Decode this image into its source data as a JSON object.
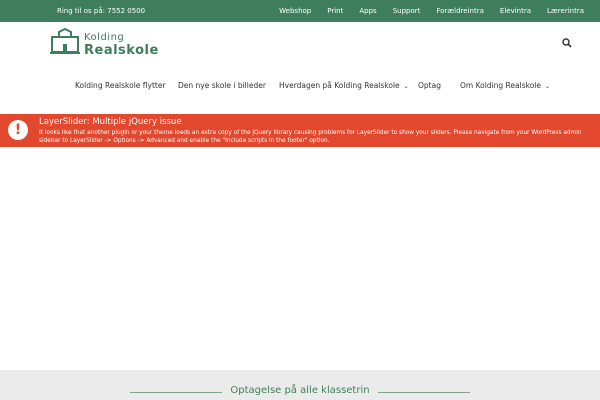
{
  "topbar": {
    "phone": "Ring til os på: 7552 0500",
    "links": [
      "Webshop",
      "Print",
      "Apps",
      "Support",
      "Forældreintra",
      "Elevintra",
      "Lærerintra"
    ]
  },
  "logo": {
    "line1": "Kolding",
    "line2": "Realskole"
  },
  "nav": {
    "items": [
      {
        "label": "Kolding Realskole flytter"
      },
      {
        "label": "Den nye skole i billeder"
      },
      {
        "label": "Hverdagen på Kolding Realskole",
        "dropdown": true
      },
      {
        "label": "Optag"
      },
      {
        "label": "Om Kolding Realskole",
        "dropdown": true
      }
    ],
    "chevron": "⌄"
  },
  "notice": {
    "badge": "!",
    "title": "LayerSlider: Multiple jQuery issue",
    "message": "It looks like that another plugin or your theme loads an extra copy of the jQuery library causing problems for LayerSlider to show your sliders. Please navigate from your WordPress admin sidebar to LayerSlider -> Options -> Advanced and enable the \"Include scripts in the footer\" option."
  },
  "section": {
    "heading": "Optagelse på alle klassetrin"
  },
  "colors": {
    "brand_green": "#3f7e5d",
    "notice_red": "#e1482e",
    "footer_gray": "#ebebeb"
  },
  "icons": {
    "search": "search-icon",
    "logo": "school-building-icon",
    "alert": "exclamation-icon"
  }
}
